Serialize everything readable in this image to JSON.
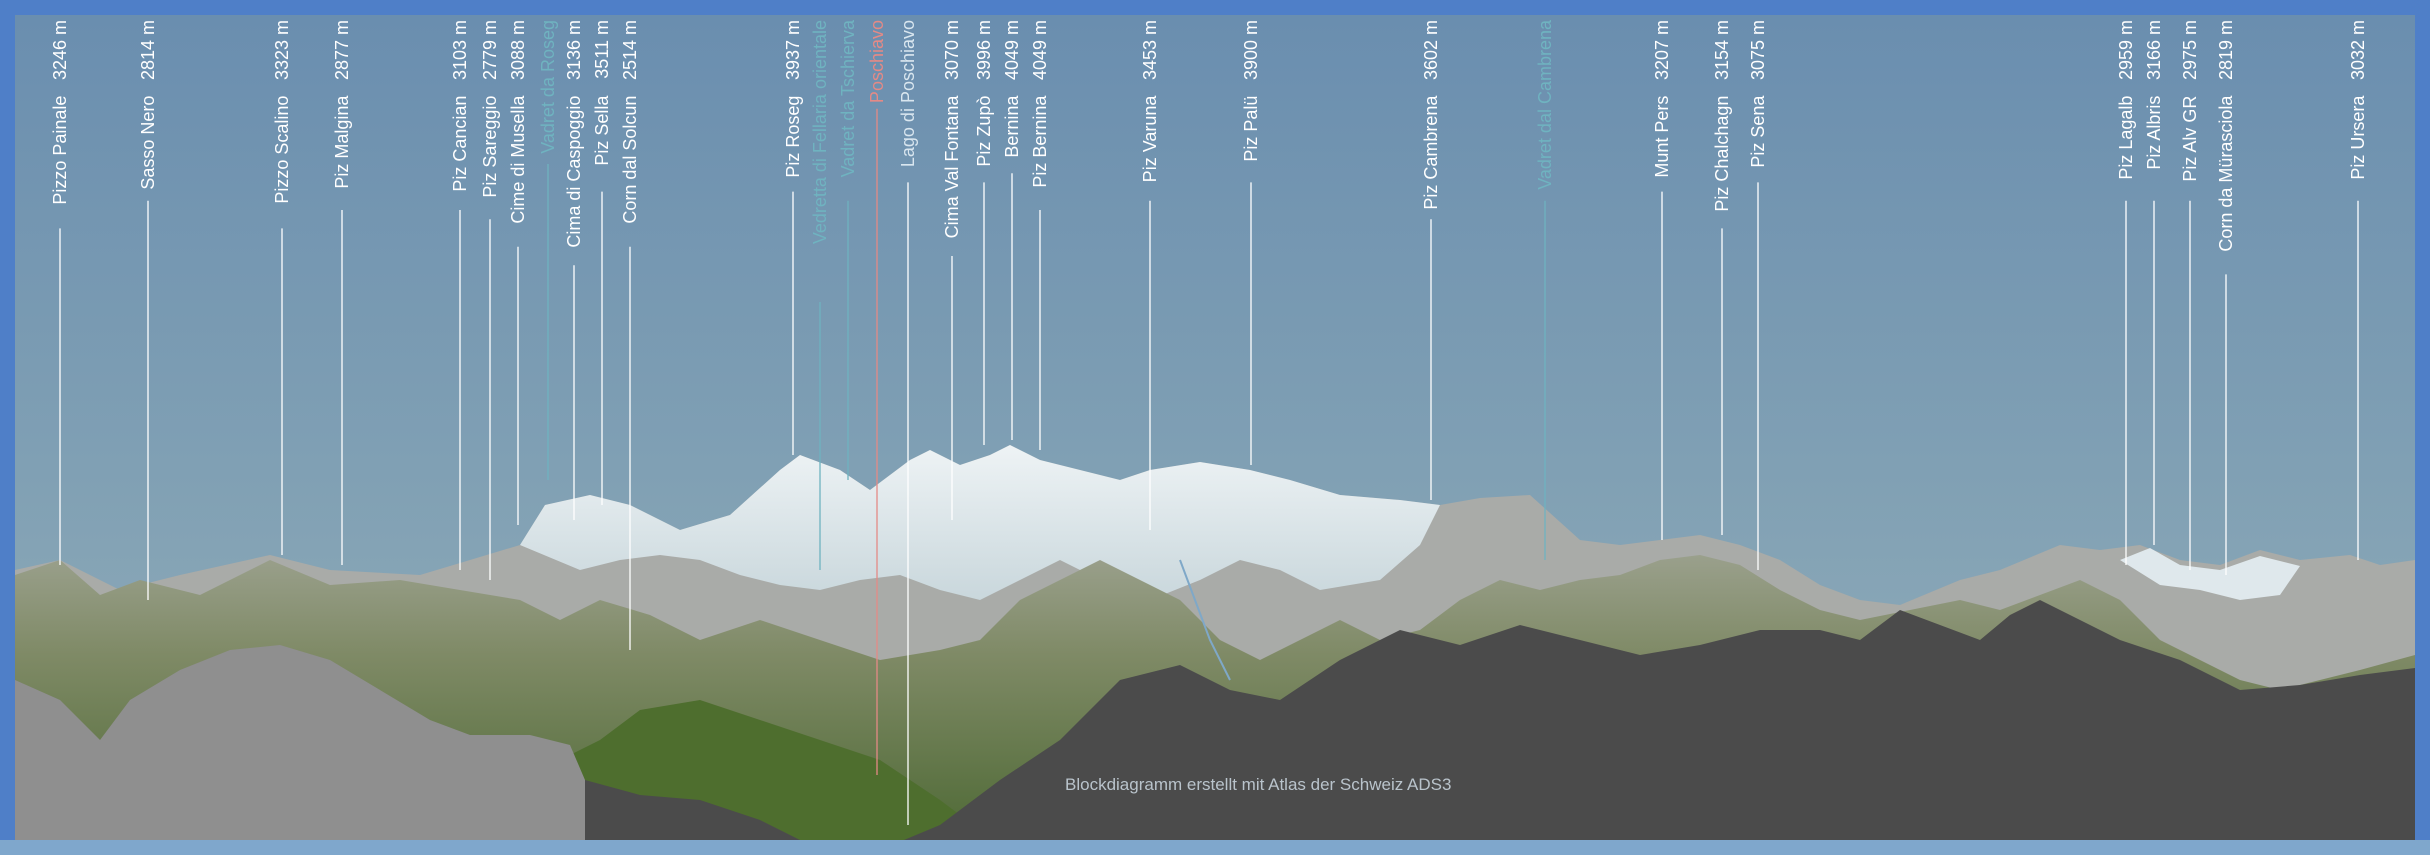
{
  "colors": {
    "frame": "#4f7fc8",
    "sky_top": "#6b8fb0",
    "sky_bottom": "#8aa7b6",
    "glacier_label": "#6fb3c0",
    "town_label": "#e48a86",
    "leader": "#ffffff"
  },
  "labels": [
    {
      "name": "Pizzo Painale",
      "height": "3246 m",
      "kind": "peak"
    },
    {
      "name": "Sasso Nero",
      "height": "2814 m",
      "kind": "peak"
    },
    {
      "name": "Pizzo Scalino",
      "height": "3323 m",
      "kind": "peak"
    },
    {
      "name": "Piz Malgina",
      "height": "2877 m",
      "kind": "peak"
    },
    {
      "name": "Piz Cancian",
      "height": "3103 m",
      "kind": "peak"
    },
    {
      "name": "Piz Sareggio",
      "height": "2779 m",
      "kind": "peak"
    },
    {
      "name": "Cime di Musella",
      "height": "3088 m",
      "kind": "peak"
    },
    {
      "name": "Vadret da Roseg",
      "height": "",
      "kind": "glacier"
    },
    {
      "name": "Cima di Caspoggio",
      "height": "3136 m",
      "kind": "peak"
    },
    {
      "name": "Piz Sella",
      "height": "3511 m",
      "kind": "peak"
    },
    {
      "name": "Corn dal Solcun",
      "height": "2514 m",
      "kind": "peak"
    },
    {
      "name": "Piz Roseg",
      "height": "3937 m",
      "kind": "peak"
    },
    {
      "name": "Vedretta di Fellaria orientale",
      "height": "",
      "kind": "glacier"
    },
    {
      "name": "Vadret da Tschierva",
      "height": "",
      "kind": "glacier"
    },
    {
      "name": "Poschiavo",
      "height": "",
      "kind": "town"
    },
    {
      "name": "Lago di Poschiavo",
      "height": "",
      "kind": "lake"
    },
    {
      "name": "Cima Val Fontana",
      "height": "3070 m",
      "kind": "peak"
    },
    {
      "name": "Piz Zupò",
      "height": "3996 m",
      "kind": "peak"
    },
    {
      "name": "Bernina",
      "height": "4049 m",
      "kind": "peak"
    },
    {
      "name": "Piz Bernina",
      "height": "4049 m",
      "kind": "peak"
    },
    {
      "name": "Piz Varuna",
      "height": "3453 m",
      "kind": "peak"
    },
    {
      "name": "Piz Palü",
      "height": "3900 m",
      "kind": "peak"
    },
    {
      "name": "Piz Cambrena",
      "height": "3602 m",
      "kind": "peak"
    },
    {
      "name": "Vadret dal Cambrena",
      "height": "",
      "kind": "glacier"
    },
    {
      "name": "Munt Pers",
      "height": "3207 m",
      "kind": "peak"
    },
    {
      "name": "Piz Chalchagn",
      "height": "3154 m",
      "kind": "peak"
    },
    {
      "name": "Piz Sena",
      "height": "3075 m",
      "kind": "peak"
    },
    {
      "name": "Piz Lagalb",
      "height": "2959 m",
      "kind": "peak"
    },
    {
      "name": "Piz Albris",
      "height": "3166 m",
      "kind": "peak"
    },
    {
      "name": "Piz Alv GR",
      "height": "2975 m",
      "kind": "peak"
    },
    {
      "name": "Corn da Mürasciola",
      "height": "2819 m",
      "kind": "peak"
    },
    {
      "name": "Piz Ursera",
      "height": "3032 m",
      "kind": "peak"
    }
  ],
  "credit": "Blockdiagramm erstellt mit Atlas der Schweiz ADS3"
}
